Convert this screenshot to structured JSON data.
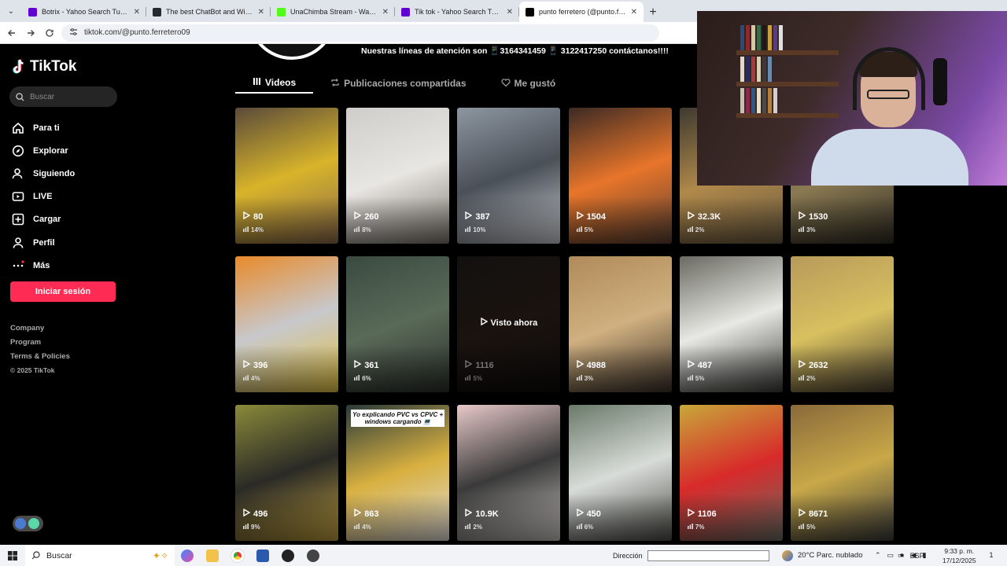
{
  "browser": {
    "tabs": [
      {
        "title": "Botrix - Yahoo Search Tus resultados",
        "favicon_color": "#6001d2"
      },
      {
        "title": "The best ChatBot and Widgets",
        "favicon_color": "#24292f"
      },
      {
        "title": "UnaChimba Stream - Watch Live",
        "favicon_color": "#53fc18"
      },
      {
        "title": "Tik tok - Yahoo Search Tus resultados",
        "favicon_color": "#6001d2"
      },
      {
        "title": "punto ferretero (@punto.ferretero)",
        "favicon_color": "#000000",
        "active": true
      }
    ],
    "new_tab": "+",
    "url": "tiktok.com/@punto.ferretero09"
  },
  "sidebar": {
    "logo": "TikTok",
    "search_placeholder": "Buscar",
    "items": [
      {
        "label": "Para ti",
        "icon": "home-icon"
      },
      {
        "label": "Explorar",
        "icon": "compass-icon"
      },
      {
        "label": "Siguiendo",
        "icon": "user-follow-icon"
      },
      {
        "label": "LIVE",
        "icon": "live-icon"
      },
      {
        "label": "Cargar",
        "icon": "upload-icon"
      },
      {
        "label": "Perfil",
        "icon": "profile-icon"
      },
      {
        "label": "Más",
        "icon": "more-icon"
      }
    ],
    "login_label": "Iniciar sesión",
    "footer": [
      "Company",
      "Program",
      "Terms & Policies"
    ],
    "copyright": "© 2025 TikTok"
  },
  "profile": {
    "bio": "Nuestras líneas de atención son 📱3164341459 📱 3122417250 contáctanos!!!!",
    "tabs": [
      {
        "label": "Videos",
        "active": true,
        "icon": "grid-icon"
      },
      {
        "label": "Publicaciones compartidas",
        "active": false,
        "icon": "repost-icon"
      },
      {
        "label": "Me gustó",
        "active": false,
        "icon": "heart-icon"
      }
    ]
  },
  "videos": [
    {
      "views": "80",
      "pct": "14%",
      "colors": [
        "#5a4a3a",
        "#d8b42a",
        "#8a6a4a"
      ]
    },
    {
      "views": "260",
      "pct": "8%",
      "colors": [
        "#cfcdc9",
        "#e8e6e2",
        "#7a746c"
      ]
    },
    {
      "views": "387",
      "pct": "10%",
      "colors": [
        "#8d96a0",
        "#4a5058",
        "#c9ccd0"
      ]
    },
    {
      "views": "1504",
      "pct": "5%",
      "colors": [
        "#3c2a24",
        "#e8752a",
        "#5a4032"
      ]
    },
    {
      "views": "32.3K",
      "pct": "2%",
      "colors": [
        "#3e3a30",
        "#b0884a",
        "#6a5a40"
      ]
    },
    {
      "views": "1530",
      "pct": "3%",
      "colors": [
        "#4a4838",
        "#8a7a52",
        "#2e2a22"
      ]
    },
    {
      "views": "396",
      "pct": "4%",
      "colors": [
        "#e88a2a",
        "#c8c8cc",
        "#e0c040"
      ]
    },
    {
      "views": "361",
      "pct": "6%",
      "colors": [
        "#3a4a40",
        "#5a6a58",
        "#2a302a"
      ]
    },
    {
      "views": "1116",
      "pct": "5%",
      "colors": [
        "#2a2622",
        "#3a2a22",
        "#1e1a18"
      ],
      "watched": "Visto ahora"
    },
    {
      "views": "4988",
      "pct": "3%",
      "colors": [
        "#b08a5a",
        "#d0b080",
        "#3a3028"
      ]
    },
    {
      "views": "487",
      "pct": "5%",
      "colors": [
        "#6a6a62",
        "#e8e8e4",
        "#3a3a36"
      ]
    },
    {
      "views": "2632",
      "pct": "2%",
      "colors": [
        "#b89a5a",
        "#d8c060",
        "#4a4030"
      ]
    },
    {
      "views": "496",
      "pct": "9%",
      "colors": [
        "#8a8a3a",
        "#2a2a26",
        "#c0a040"
      ]
    },
    {
      "views": "863",
      "pct": "4%",
      "colors": [
        "#2a3a3a",
        "#d8b040",
        "#e0ddd8"
      ],
      "caption": "Yo explicando PVC vs CPVC + windows cargando 💻"
    },
    {
      "views": "10.9K",
      "pct": "2%",
      "colors": [
        "#e8c8c8",
        "#3a3a3a",
        "#c8c4c0"
      ]
    },
    {
      "views": "450",
      "pct": "6%",
      "colors": [
        "#6a7a6a",
        "#d8dcd8",
        "#4a4a44"
      ]
    },
    {
      "views": "1106",
      "pct": "7%",
      "colors": [
        "#c8a83a",
        "#d82a2a",
        "#6a6a60"
      ]
    },
    {
      "views": "8671",
      "pct": "5%",
      "colors": [
        "#8a6a3a",
        "#c8a848",
        "#3a3a3a"
      ]
    }
  ],
  "taskbar": {
    "search_placeholder": "Buscar",
    "address_label": "Dirección",
    "weather": "20°C  Parc. nublado",
    "language": "ESP",
    "time": "9:33 p. m.",
    "date": "17/12/2025",
    "notifications": "1"
  }
}
